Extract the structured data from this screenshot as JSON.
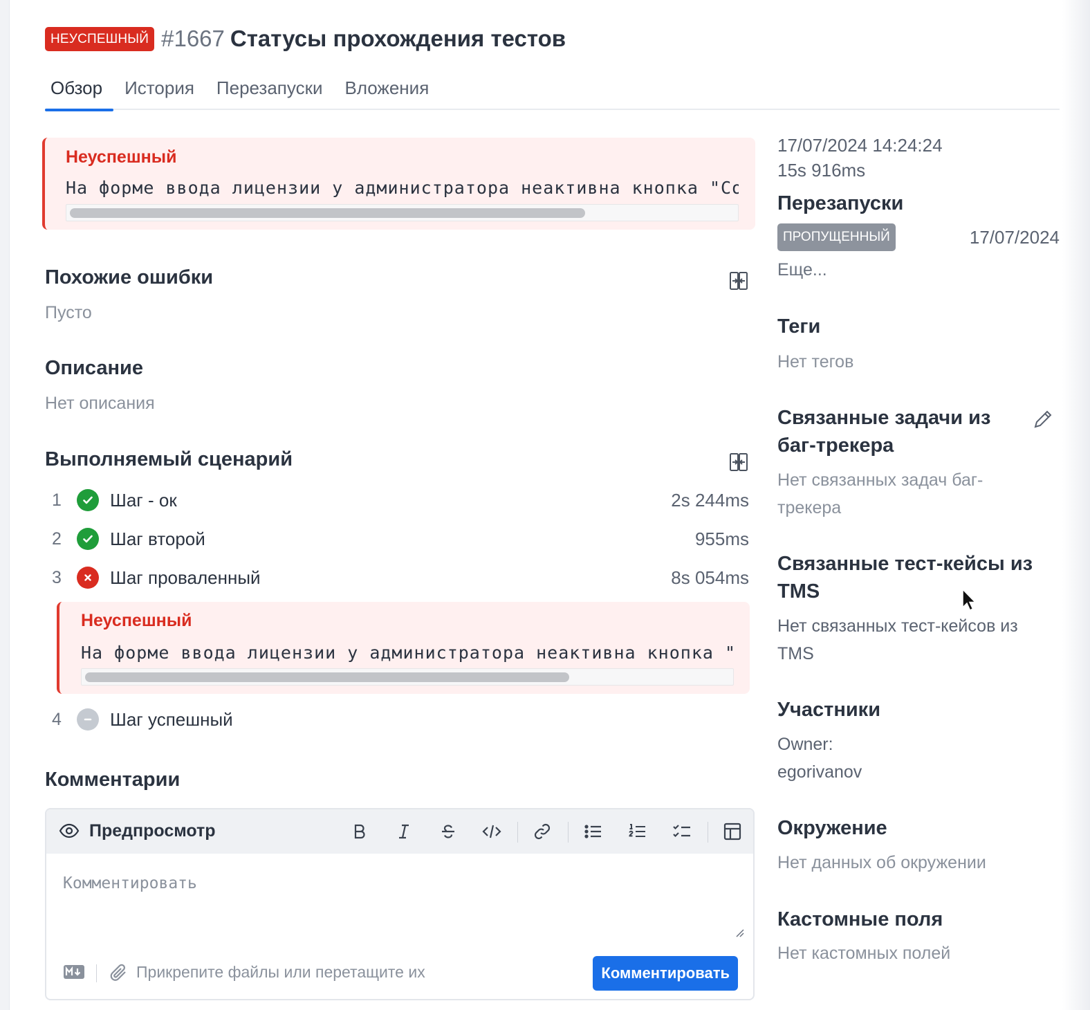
{
  "header": {
    "status": "НЕУСПЕШНЫЙ",
    "test_id": "#1667",
    "title": "Статусы прохождения тестов"
  },
  "tabs": [
    "Обзор",
    "История",
    "Перезапуски",
    "Вложения"
  ],
  "active_tab": "Обзор",
  "error": {
    "title": "Неуспешный",
    "message": "На форме ввода лицензии у администратора неактивна кнопка \"Сохранить\"",
    "scroll_fraction": 0.77
  },
  "similar_errors": {
    "title": "Похожие ошибки",
    "value": "Пусто"
  },
  "description": {
    "title": "Описание",
    "value": "Нет описания"
  },
  "scenario": {
    "title": "Выполняемый сценарий",
    "steps": [
      {
        "num": "1",
        "name": "Шаг - ок",
        "duration": "2s 244ms",
        "status": "passed"
      },
      {
        "num": "2",
        "name": "Шаг второй",
        "duration": "955ms",
        "status": "passed"
      },
      {
        "num": "3",
        "name": "Шаг проваленный",
        "duration": "8s 054ms",
        "status": "failed"
      },
      {
        "num": "4",
        "name": "Шаг успешный",
        "duration": "",
        "status": "skipped"
      }
    ],
    "step_error": {
      "title": "Неуспешный",
      "message": "На форме ввода лицензии у администратора неактивна кнопка \"Сохранить\"",
      "scroll_fraction": 0.74
    }
  },
  "comments": {
    "title": "Комментарии",
    "preview_label": "Предпросмотр",
    "placeholder": "Комментировать",
    "attach_hint": "Прикрепите файлы или перетащите их",
    "submit_label": "Комментировать"
  },
  "sidebar": {
    "datetime": "17/07/2024 14:24:24",
    "duration": "15s 916ms",
    "reruns": {
      "title": "Перезапуски",
      "items": [
        {
          "status": "ПРОПУЩЕННЫЙ",
          "date": "17/07/2024"
        }
      ],
      "more": "Еще..."
    },
    "tags": {
      "title": "Теги",
      "value": "Нет тегов"
    },
    "bugtracker": {
      "title_line1": "Связанные задачи из",
      "title_line2": "баг-трекера",
      "value_line1": "Нет связанных задач баг-",
      "value_line2": "трекера"
    },
    "tms": {
      "title_line1": "Связанные тест-кейсы из",
      "title_line2": "TMS",
      "value_line1": "Нет связанных тест-кейсов из",
      "value_line2": "TMS"
    },
    "participants": {
      "title": "Участники",
      "owner_label": "Owner:",
      "owner": "egorivanov"
    },
    "environment": {
      "title": "Окружение",
      "value": "Нет данных об окружении"
    },
    "custom_fields": {
      "title": "Кастомные поля",
      "value": "Нет кастомных полей"
    }
  },
  "colors": {
    "failed": "#d92c20",
    "passed": "#1f9d3a",
    "skipped": "#c5cad1",
    "accent": "#1a6fe8",
    "error_bg": "#fff0f0"
  }
}
